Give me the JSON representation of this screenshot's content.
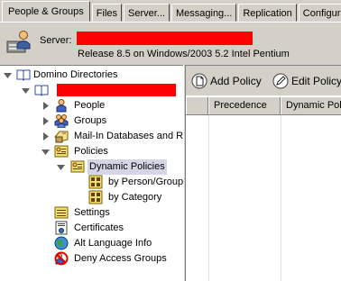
{
  "tabs": [
    {
      "label": "People & Groups",
      "active": true
    },
    {
      "label": "Files",
      "active": false
    },
    {
      "label": "Server...",
      "active": false
    },
    {
      "label": "Messaging...",
      "active": false
    },
    {
      "label": "Replication",
      "active": false
    },
    {
      "label": "Configurati",
      "active": false
    }
  ],
  "server": {
    "label": "Server:",
    "release": "Release 8.5 on Windows/2003 5.2 Intel Pentium",
    "redacted_color": "#ff0000"
  },
  "tree": {
    "root": "Domino Directories",
    "items": [
      {
        "label": "People",
        "icon": "people-icon"
      },
      {
        "label": "Groups",
        "icon": "groups-icon"
      },
      {
        "label": "Mail-In Databases and R",
        "icon": "mailin-icon"
      },
      {
        "label": "Policies",
        "icon": "policies-icon"
      },
      {
        "label": "Dynamic Policies",
        "icon": "dynamic-policies-icon"
      },
      {
        "label": "by Person/Group",
        "icon": "view-icon"
      },
      {
        "label": "by Category",
        "icon": "view-icon"
      },
      {
        "label": "Settings",
        "icon": "settings-icon"
      },
      {
        "label": "Certificates",
        "icon": "certificates-icon"
      },
      {
        "label": "Alt Language Info",
        "icon": "globe-icon"
      },
      {
        "label": "Deny Access Groups",
        "icon": "deny-icon"
      }
    ]
  },
  "toolbar": {
    "add_policy": "Add Policy",
    "edit_policy": "Edit Policy"
  },
  "grid": {
    "columns": [
      "Precedence",
      "Dynamic Pol"
    ]
  }
}
